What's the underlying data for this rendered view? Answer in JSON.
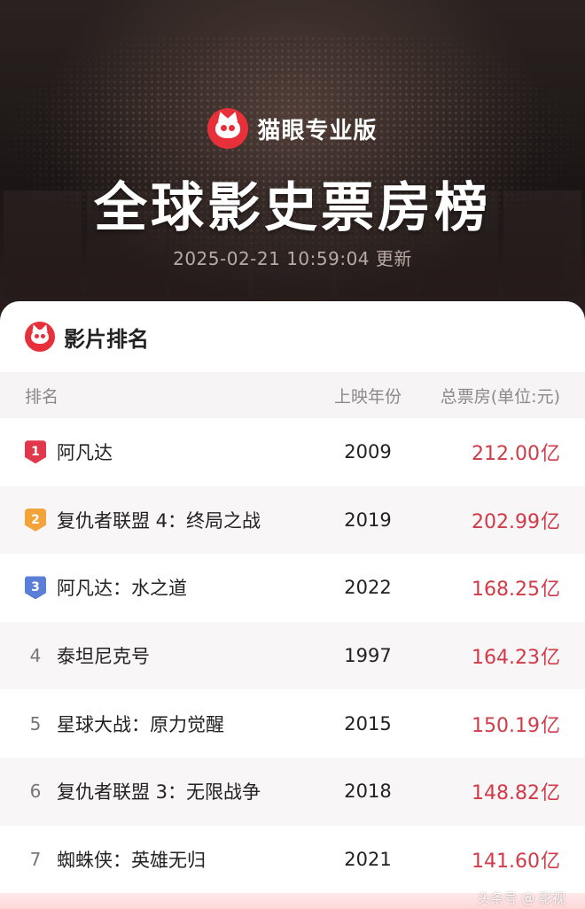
{
  "header": {
    "brand_name": "猫眼专业版",
    "title": "全球影史票房榜",
    "update_time": "2025-02-21 10:59:04 更新"
  },
  "card": {
    "title": "影片排名",
    "columns": {
      "rank": "排名",
      "year": "上映年份",
      "box_office": "总票房(单位:元)"
    },
    "rows": [
      {
        "rank": "1",
        "name": "阿凡达",
        "year": "2009",
        "box": "212.00",
        "unit": "亿",
        "badge_color": "#e0384a"
      },
      {
        "rank": "2",
        "name": "复仇者联盟 4：终局之战",
        "year": "2019",
        "box": "202.99",
        "unit": "亿",
        "badge_color": "#f2a43a"
      },
      {
        "rank": "3",
        "name": "阿凡达：水之道",
        "year": "2022",
        "box": "168.25",
        "unit": "亿",
        "badge_color": "#5b7fd6"
      },
      {
        "rank": "4",
        "name": "泰坦尼克号",
        "year": "1997",
        "box": "164.23",
        "unit": "亿"
      },
      {
        "rank": "5",
        "name": "星球大战：原力觉醒",
        "year": "2015",
        "box": "150.19",
        "unit": "亿"
      },
      {
        "rank": "6",
        "name": "复仇者联盟 3：无限战争",
        "year": "2018",
        "box": "148.82",
        "unit": "亿"
      },
      {
        "rank": "7",
        "name": "蜘蛛侠：英雄无归",
        "year": "2021",
        "box": "141.60",
        "unit": "亿"
      }
    ]
  },
  "colors": {
    "accent": "#d23a48",
    "brand": "#e8303a"
  }
}
